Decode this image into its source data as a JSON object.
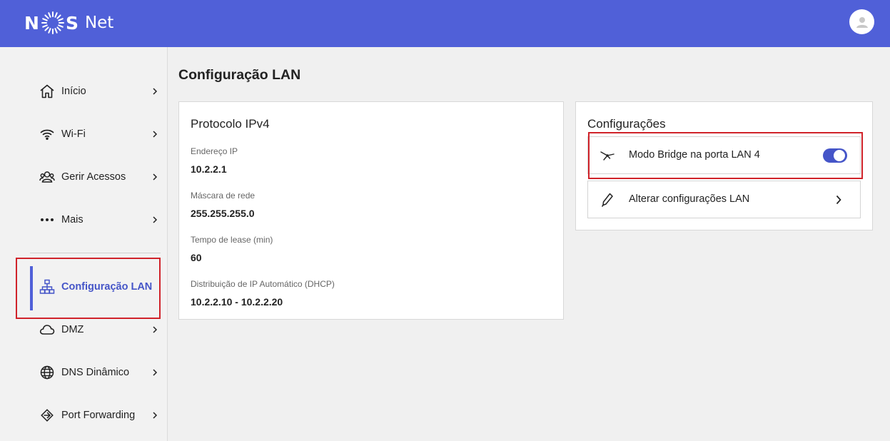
{
  "header": {
    "brand": "N S",
    "brand_suffix": "Net",
    "brand_color": "#5060d8",
    "avatar_icon": "user-avatar-icon"
  },
  "sidebar": {
    "items": [
      {
        "label": "Início",
        "icon": "home-icon"
      },
      {
        "label": "Wi-Fi",
        "icon": "wifi-icon"
      },
      {
        "label": "Gerir Acessos",
        "icon": "users-icon"
      },
      {
        "label": "Mais",
        "icon": "more-icon"
      },
      {
        "label": "Configuração LAN",
        "icon": "network-icon",
        "active": true
      },
      {
        "label": "DMZ",
        "icon": "cloud-icon"
      },
      {
        "label": "DNS Dinâmico",
        "icon": "globe-icon"
      },
      {
        "label": "Port Forwarding",
        "icon": "port-forward-icon"
      }
    ]
  },
  "main": {
    "title": "Configuração LAN",
    "ipv4": {
      "title": "Protocolo IPv4",
      "fields": [
        {
          "label": "Endereço IP",
          "value": "10.2.2.1"
        },
        {
          "label": "Máscara de rede",
          "value": "255.255.255.0"
        },
        {
          "label": "Tempo de lease (min)",
          "value": "60"
        },
        {
          "label": "Distribuição de IP Automático (DHCP)",
          "value": "10.2.2.10 - 10.2.2.20"
        }
      ]
    },
    "config": {
      "title": "Configurações",
      "bridge_label": "Modo Bridge na porta LAN 4",
      "bridge_enabled": true,
      "lan_label": "Alterar configurações LAN"
    }
  },
  "colors": {
    "accent": "#4555c8",
    "highlight": "#d0232a"
  }
}
